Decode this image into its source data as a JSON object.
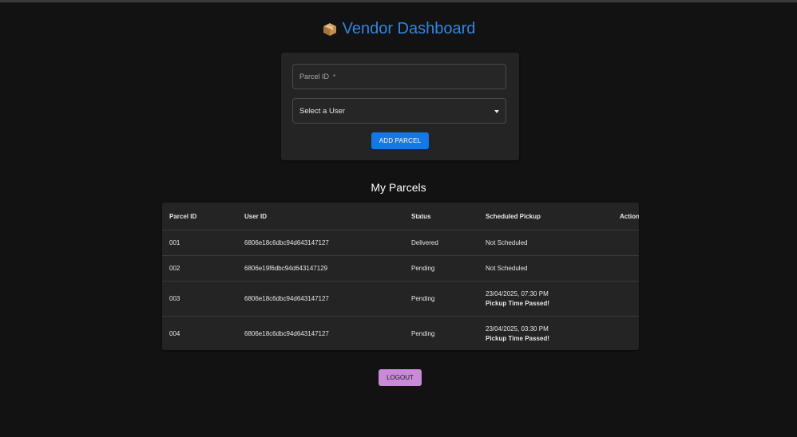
{
  "header": {
    "icon": "package-icon",
    "title": "Vendor Dashboard",
    "title_color": "#2f86e6"
  },
  "form": {
    "parcel_id_placeholder": "Parcel ID",
    "parcel_id_required_mark": "*",
    "user_select_label": "Select a User",
    "add_button_label": "ADD PARCEL",
    "accent_color": "#1677e6"
  },
  "parcels": {
    "title": "My Parcels",
    "columns": [
      "Parcel ID",
      "User ID",
      "Status",
      "Scheduled Pickup",
      "Action"
    ],
    "rows": [
      {
        "parcel_id": "001",
        "user_id": "6806e18c6dbc94d643147127",
        "status": "Delivered",
        "pickup": "Not Scheduled",
        "pickup_note": ""
      },
      {
        "parcel_id": "002",
        "user_id": "6806e19f6dbc94d643147129",
        "status": "Pending",
        "pickup": "Not Scheduled",
        "pickup_note": ""
      },
      {
        "parcel_id": "003",
        "user_id": "6806e18c6dbc94d643147127",
        "status": "Pending",
        "pickup": "23/04/2025, 07:30 PM",
        "pickup_note": "Pickup Time Passed!"
      },
      {
        "parcel_id": "004",
        "user_id": "6806e18c6dbc94d643147127",
        "status": "Pending",
        "pickup": "23/04/2025, 03:30 PM",
        "pickup_note": "Pickup Time Passed!"
      }
    ]
  },
  "footer": {
    "logout_label": "LOGOUT",
    "logout_color": "#c98ad6"
  }
}
